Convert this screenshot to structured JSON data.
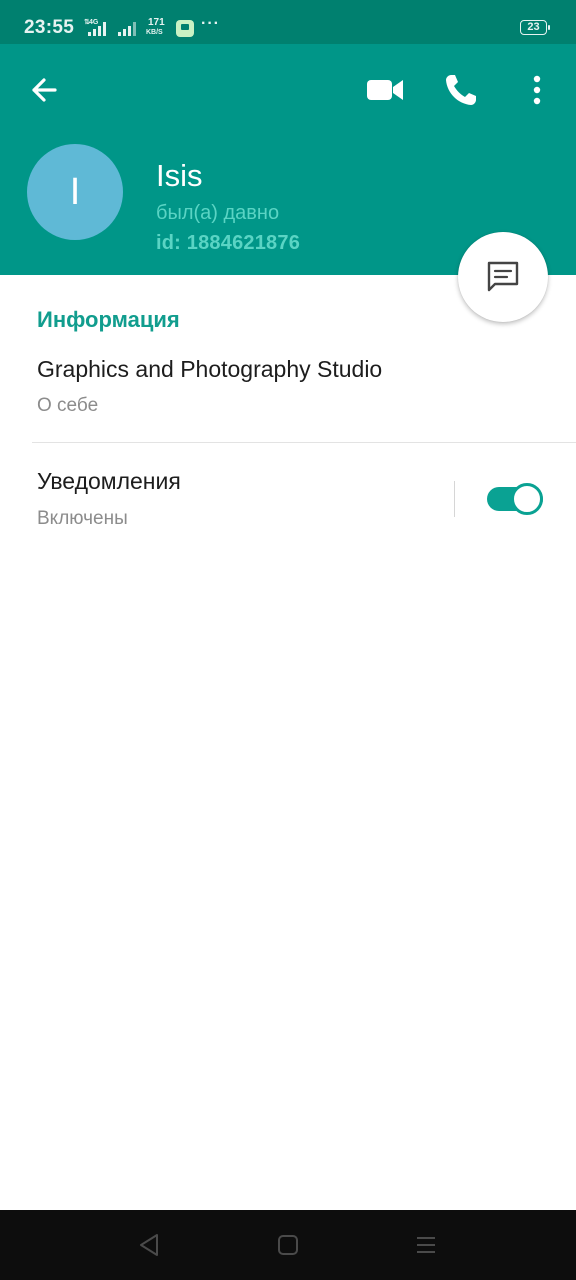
{
  "status_bar": {
    "time": "23:55",
    "network": "4G",
    "speed_value": "171",
    "speed_unit": "KB/S",
    "more": "···",
    "battery_level": "23"
  },
  "header": {
    "back_icon": "arrow-left-icon",
    "video_icon": "video-camera-icon",
    "call_icon": "phone-icon",
    "menu_icon": "more-vertical-icon",
    "avatar_letter": "I",
    "avatar_color": "#5fb9d6",
    "name": "Isis",
    "last_seen": "был(а) давно",
    "id_text": "id: 1884621876",
    "background_color": "#009688"
  },
  "fab": {
    "icon": "message-icon"
  },
  "info": {
    "section_title": "Информация",
    "bio": "Graphics and Photography Studio",
    "bio_label": "О себе"
  },
  "notifications": {
    "title": "Уведомления",
    "status": "Включены",
    "enabled": true
  },
  "nav_bar": {
    "back_icon": "triangle-back-icon",
    "home_icon": "square-home-icon",
    "recents_icon": "menu-lines-icon"
  },
  "colors": {
    "accent": "#009688",
    "section_title": "#119d8e",
    "toggle_on": "#0aa293"
  }
}
